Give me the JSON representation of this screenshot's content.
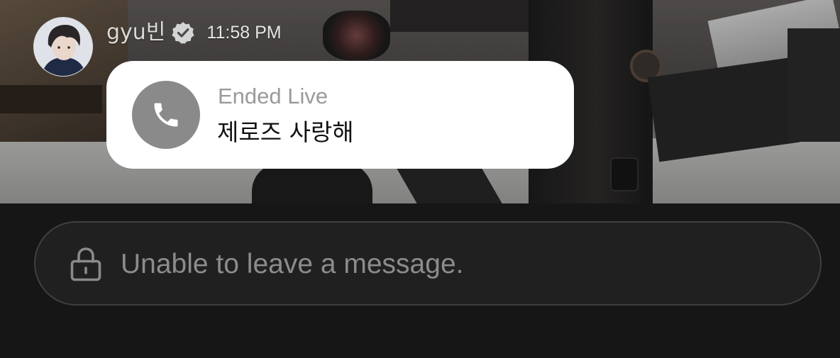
{
  "header": {
    "username": "gyu빈",
    "verified_icon": "verified-badge-icon",
    "timestamp": "11:58 PM",
    "avatar": "avatar"
  },
  "message": {
    "icon": "phone-icon",
    "status": "Ended Live",
    "title": "제로즈 사랑해"
  },
  "composer": {
    "icon": "lock-icon",
    "placeholder": "Unable to leave a message."
  },
  "colors": {
    "bubble": "#ffffff",
    "call_circle": "#8a8a8a",
    "status_text": "#9a9a9a",
    "bottom_background": "#161616",
    "input_border": "#3f3f3f",
    "placeholder_text": "#8c8c8c"
  }
}
